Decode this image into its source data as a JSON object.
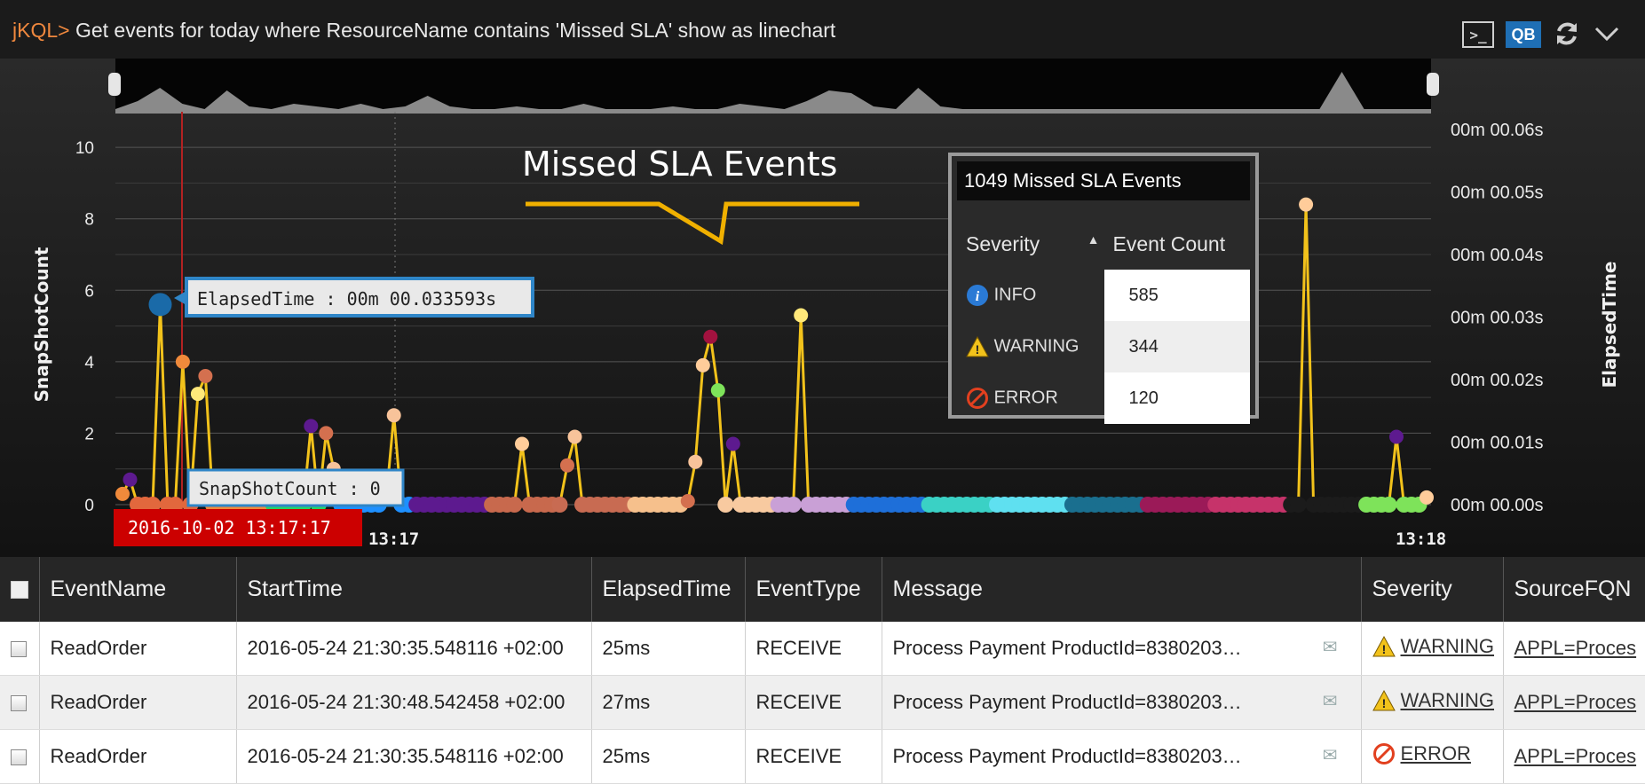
{
  "query": {
    "prompt": "jKQL>",
    "text": " Get events for today where ResourceName contains 'Missed SLA' show as linechart"
  },
  "toolbar": {
    "qb_label": "QB",
    "console_label": ">_",
    "icons": [
      "console-icon",
      "query-builder-icon",
      "refresh-icon",
      "chevron-down-icon"
    ]
  },
  "chart_data": {
    "type": "line",
    "title": "Missed SLA Events",
    "y_left_label": "SnapShotCount",
    "y_right_label": "ElapsedTime",
    "y_left_ticks": [
      "0",
      "2",
      "4",
      "6",
      "8",
      "10"
    ],
    "y_right_ticks": [
      "00m 00.00s",
      "00m 00.01s",
      "00m 00.02s",
      "00m 00.03s",
      "00m 00.04s",
      "00m 00.05s",
      "00m 00.06s"
    ],
    "ylim": [
      0,
      10.5
    ],
    "x_ticks": [
      "13:17",
      "13:18"
    ],
    "grid": true,
    "series": [
      {
        "values": [
          0.3,
          0.7,
          0,
          0,
          0,
          5.6,
          0,
          0,
          4,
          0,
          3.1,
          3.6,
          0,
          0,
          0,
          0,
          0,
          0,
          0,
          0,
          0,
          0,
          0,
          0,
          0,
          2.2,
          0,
          2,
          1,
          0,
          0,
          0,
          0,
          0,
          0,
          0.2,
          2.5,
          0,
          0,
          0,
          0,
          0,
          0,
          0,
          0,
          0,
          0,
          0,
          0,
          0,
          0,
          0,
          0,
          1.7,
          0,
          0,
          0,
          0,
          0,
          1.1,
          1.9,
          0,
          0,
          0,
          0,
          0,
          0,
          0,
          0,
          0,
          0,
          0,
          0,
          0,
          0,
          0.1,
          1.2,
          3.9,
          4.7,
          3.2,
          0,
          1.7,
          0,
          0,
          0,
          0,
          0,
          0,
          0,
          0,
          5.3,
          0,
          0,
          0,
          0,
          0,
          0,
          0,
          0,
          0,
          0,
          0,
          0,
          0,
          0,
          0,
          0,
          0,
          0,
          0,
          0,
          0,
          0,
          0,
          0,
          0,
          0,
          0,
          0,
          0,
          0,
          0,
          0,
          0,
          0,
          0,
          0,
          0,
          0,
          0,
          0,
          0,
          0,
          0,
          0,
          0,
          0,
          0,
          0,
          0,
          0,
          0,
          0,
          0,
          0,
          0,
          0,
          0,
          0,
          0,
          0,
          0,
          0,
          0,
          0,
          0,
          0,
          8.4,
          0,
          0,
          0,
          0,
          0,
          0,
          0,
          0,
          0,
          0,
          0,
          1.9,
          0,
          0,
          0,
          0.2
        ]
      }
    ],
    "overview_peaks": [
      0.1,
      0.4,
      0.9,
      0.3,
      0.1,
      0.8,
      0.2,
      0.1,
      0.3,
      0.2,
      0.1,
      0.3,
      0.1,
      0.2,
      0.6,
      0.2,
      0.1,
      0.1,
      0.2,
      0.1,
      0.1,
      0.3,
      0.1,
      0.1,
      0.1,
      0.2,
      0.1,
      0.1,
      0.3,
      0.2,
      0.1,
      0.4,
      0.8,
      0.7,
      0.2,
      0.1,
      0.9,
      0.2,
      0.1,
      0.1,
      0.1,
      0.1,
      0.1,
      0.1,
      0.1,
      0.1,
      0.1,
      0.1,
      0.1,
      0.1,
      0.1,
      0.1,
      0.1,
      0.1,
      0.1,
      1.5,
      0.1,
      0.1,
      0.1,
      0.1
    ],
    "hover_tooltip_elapsed": "ElapsedTime : 00m 00.033593s",
    "hover_tooltip_count": "SnapShotCount : 0",
    "hover_time_label": "2016-10-02 13:17:17",
    "colors": {
      "line": "#f2c21b",
      "crosshair": "#b22222",
      "annotation": "#f0b000",
      "time_label_bg": "#cc0000"
    }
  },
  "popup": {
    "title": "1049 Missed SLA Events",
    "col_severity": "Severity",
    "col_count": "Event Count",
    "rows": [
      {
        "icon": "info-icon",
        "label": "INFO",
        "count": "585"
      },
      {
        "icon": "warning-icon",
        "label": "WARNING",
        "count": "344"
      },
      {
        "icon": "error-icon",
        "label": "ERROR",
        "count": "120"
      }
    ]
  },
  "table": {
    "columns": [
      "EventName",
      "StartTime",
      "ElapsedTime",
      "EventType",
      "Message",
      "Severity",
      "SourceFQN"
    ],
    "rows": [
      {
        "event_name": "ReadOrder",
        "start_time": "2016-05-24 21:30:35.548116 +02:00",
        "elapsed": "25ms",
        "event_type": "RECEIVE",
        "message": "Process Payment ProductId=8380203…",
        "severity": "WARNING",
        "source": "APPL=Proces"
      },
      {
        "event_name": "ReadOrder",
        "start_time": "2016-05-24 21:30:48.542458 +02:00",
        "elapsed": "27ms",
        "event_type": "RECEIVE",
        "message": "Process Payment ProductId=8380203…",
        "severity": "WARNING",
        "source": "APPL=Proces"
      },
      {
        "event_name": "ReadOrder",
        "start_time": "2016-05-24 21:30:35.548116 +02:00",
        "elapsed": "25ms",
        "event_type": "RECEIVE",
        "message": "Process Payment ProductId=8380203…",
        "severity": "ERROR",
        "source": "APPL=Proces"
      }
    ]
  }
}
